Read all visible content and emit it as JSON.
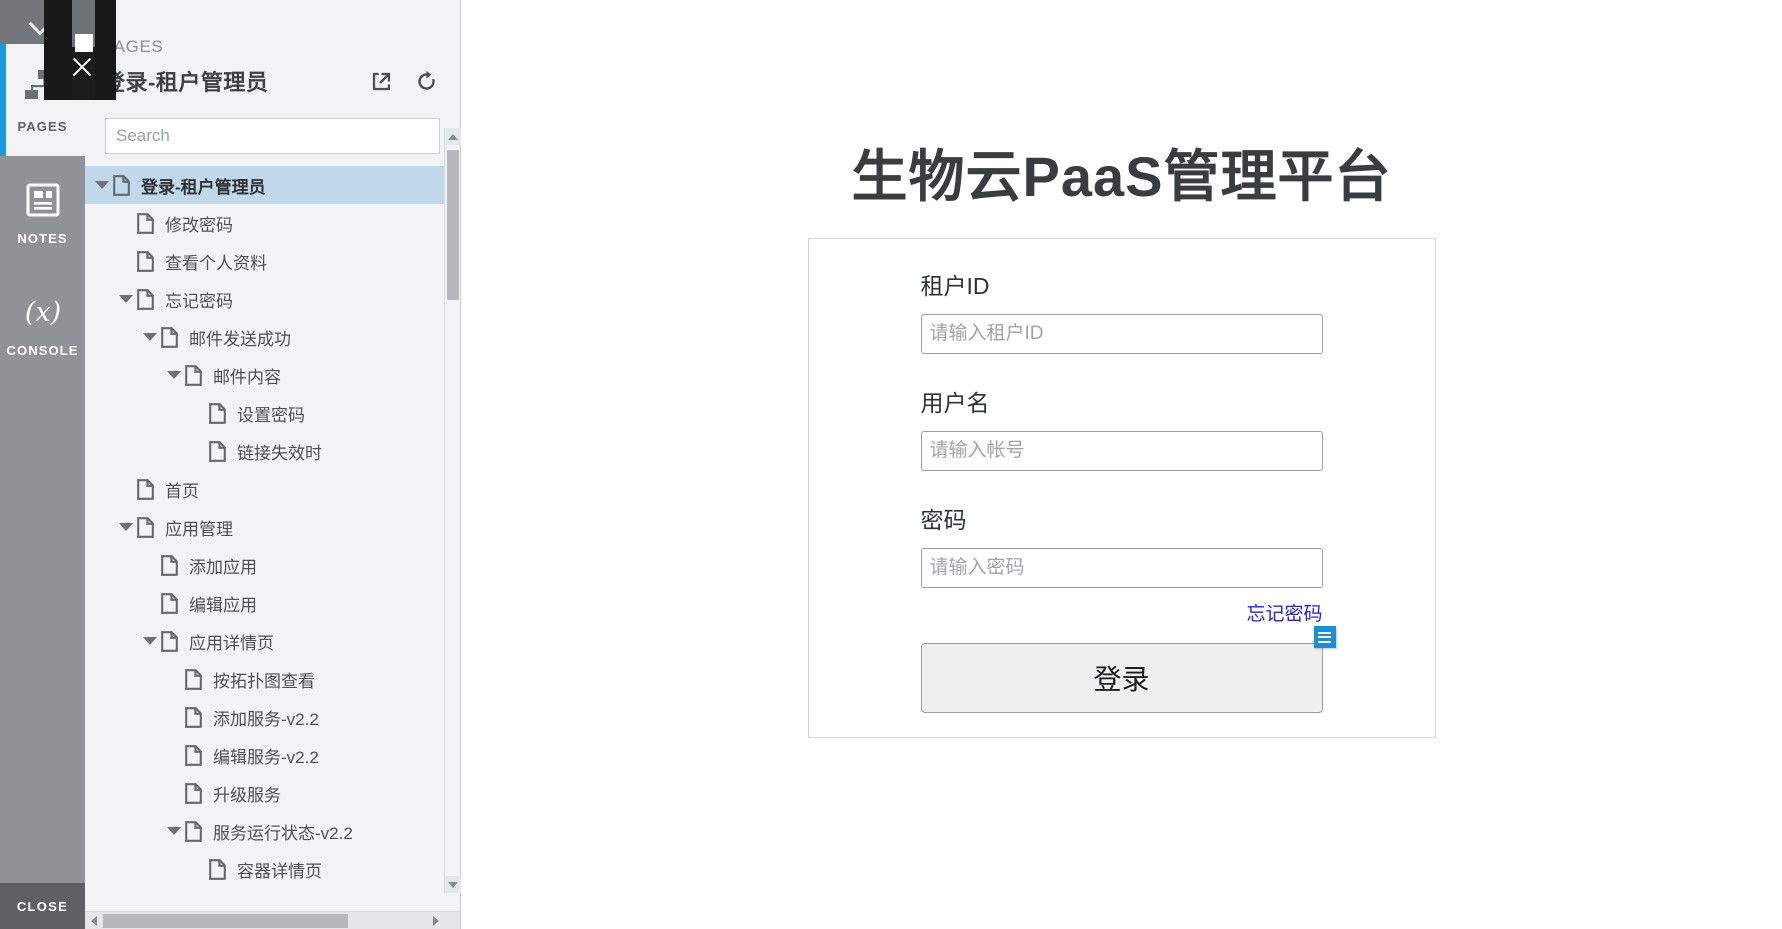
{
  "rail": {
    "collapse_icon": "chevron-down-icon",
    "items": [
      {
        "label": "PAGES",
        "icon": "sitemap-icon",
        "active": true
      },
      {
        "label": "NOTES",
        "icon": "notes-icon",
        "active": false
      },
      {
        "label": "CONSOLE",
        "icon": "variable-icon",
        "active": false
      }
    ],
    "close_label": "CLOSE"
  },
  "panel": {
    "kicker": "PAGES",
    "title": "登录-租户管理员",
    "actions": [
      {
        "name": "open-in-new-window-icon",
        "title": ""
      },
      {
        "name": "refresh-icon",
        "title": ""
      }
    ],
    "search": {
      "placeholder": "Search",
      "value": ""
    },
    "tree": [
      {
        "label": "登录-租户管理员",
        "depth": 0,
        "arrow": "down",
        "selected": true
      },
      {
        "label": "修改密码",
        "depth": 1,
        "arrow": "none",
        "selected": false
      },
      {
        "label": "查看个人资料",
        "depth": 1,
        "arrow": "none",
        "selected": false
      },
      {
        "label": "忘记密码",
        "depth": 1,
        "arrow": "down",
        "selected": false
      },
      {
        "label": "邮件发送成功",
        "depth": 2,
        "arrow": "down",
        "selected": false
      },
      {
        "label": "邮件内容",
        "depth": 3,
        "arrow": "down",
        "selected": false
      },
      {
        "label": "设置密码",
        "depth": 4,
        "arrow": "none",
        "selected": false
      },
      {
        "label": "链接失效时",
        "depth": 4,
        "arrow": "none",
        "selected": false
      },
      {
        "label": "首页",
        "depth": 1,
        "arrow": "none",
        "selected": false
      },
      {
        "label": "应用管理",
        "depth": 1,
        "arrow": "down",
        "selected": false
      },
      {
        "label": "添加应用",
        "depth": 2,
        "arrow": "none",
        "selected": false
      },
      {
        "label": "编辑应用",
        "depth": 2,
        "arrow": "none",
        "selected": false
      },
      {
        "label": "应用详情页",
        "depth": 2,
        "arrow": "down",
        "selected": false
      },
      {
        "label": "按拓扑图查看",
        "depth": 3,
        "arrow": "none",
        "selected": false
      },
      {
        "label": "添加服务-v2.2",
        "depth": 3,
        "arrow": "none",
        "selected": false
      },
      {
        "label": "编辑服务-v2.2",
        "depth": 3,
        "arrow": "none",
        "selected": false
      },
      {
        "label": "升级服务",
        "depth": 3,
        "arrow": "none",
        "selected": false
      },
      {
        "label": "服务运行状态-v2.2",
        "depth": 3,
        "arrow": "down",
        "selected": false
      },
      {
        "label": "容器详情页",
        "depth": 4,
        "arrow": "none",
        "selected": false
      }
    ]
  },
  "canvas": {
    "page_title": "生物云PaaS管理平台",
    "form": {
      "tenant": {
        "label": "租户ID",
        "placeholder": "请输入租户ID",
        "value": ""
      },
      "username": {
        "label": "用户名",
        "placeholder": "请输入帐号",
        "value": ""
      },
      "password": {
        "label": "密码",
        "placeholder": "请输入密码",
        "value": ""
      },
      "forgot_link": "忘记密码",
      "submit_label": "登录",
      "note_badge_icon": "interaction-note-icon"
    }
  },
  "overlay": {
    "close_icon": "close-icon"
  },
  "colors": {
    "rail_bg": "#8f9398",
    "rail_active_bg": "#f2f3f4",
    "accent_blue": "#1c9ae0",
    "panel_bg": "#f2f3f4",
    "tree_selected": "#bfd9ea",
    "link_blue": "#2222ee",
    "badge_blue": "#1a8fd8",
    "title_text": "#3a3d40"
  }
}
